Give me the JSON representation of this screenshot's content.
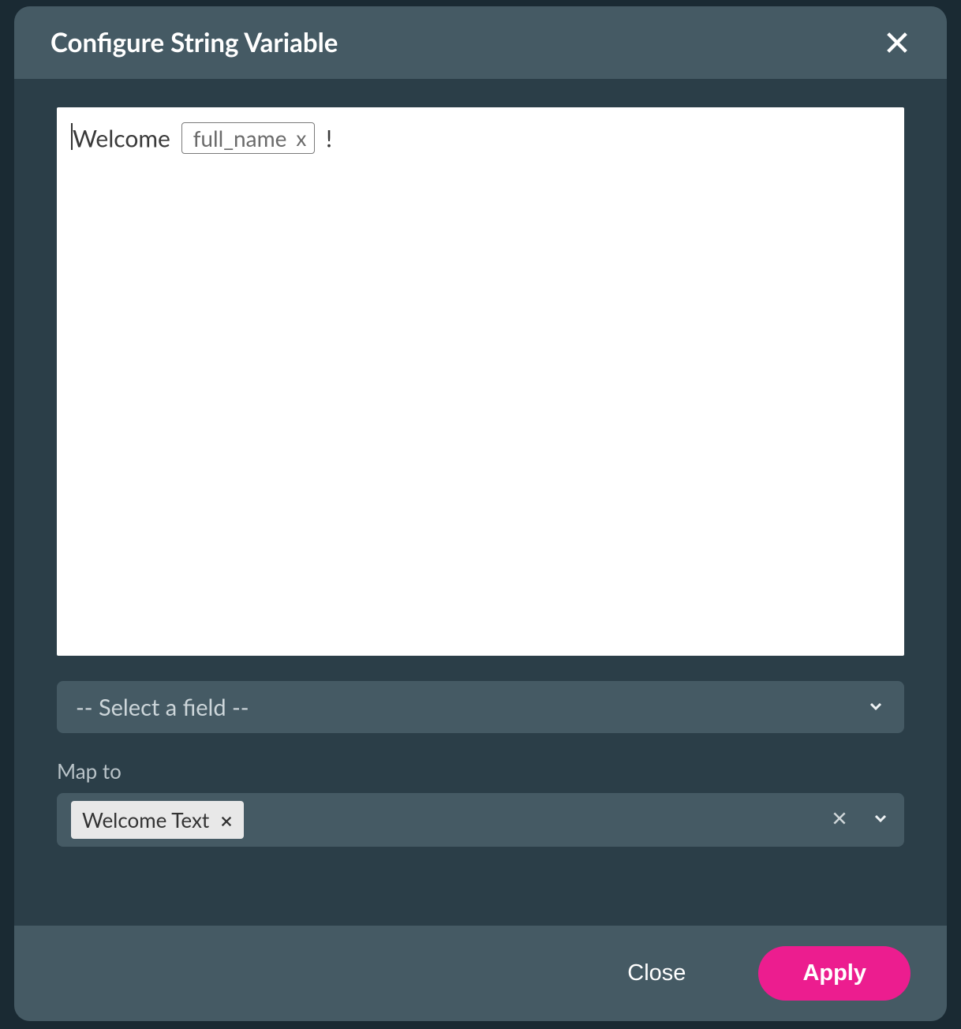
{
  "modal": {
    "title": "Configure String Variable"
  },
  "editor": {
    "text_before": "Welcome ",
    "variable_name": "full_name",
    "variable_remove_label": "x",
    "text_after": " !"
  },
  "field_select": {
    "placeholder": "-- Select a field --"
  },
  "map_to": {
    "label": "Map to",
    "tag": "Welcome Text"
  },
  "footer": {
    "close_label": "Close",
    "apply_label": "Apply"
  }
}
